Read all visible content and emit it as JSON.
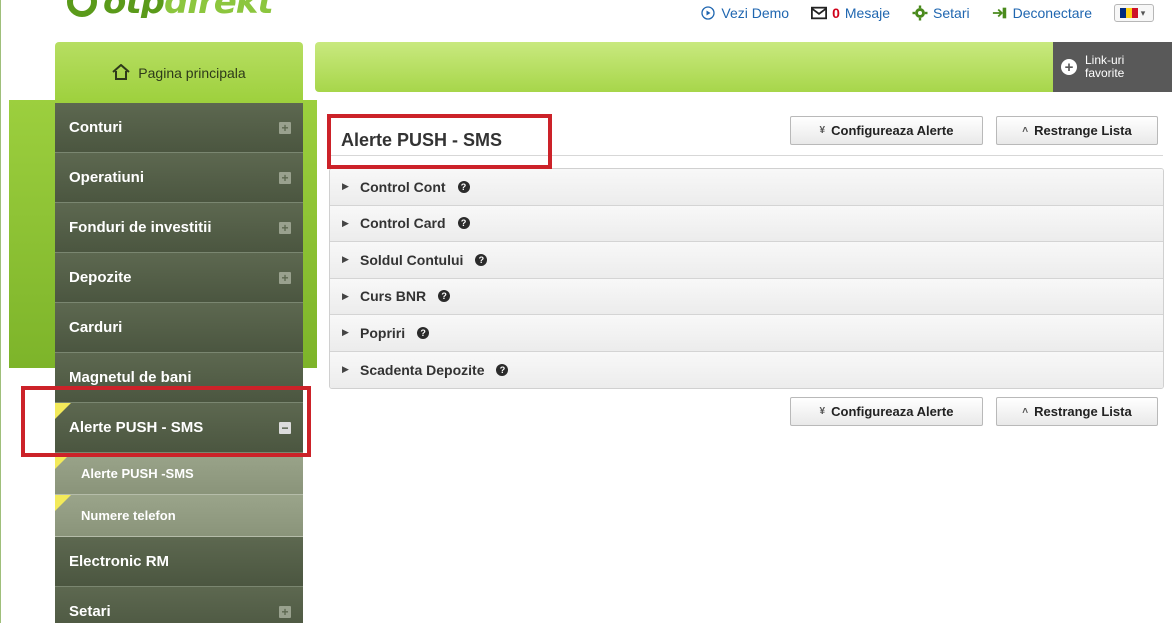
{
  "brand": {
    "logo_main": "otp",
    "logo_suffix": "direkt"
  },
  "topnav": {
    "demo": "Vezi Demo",
    "messages_count": "0",
    "messages": "Mesaje",
    "settings": "Setari",
    "logout": "Deconectare"
  },
  "home": {
    "label": "Pagina principala"
  },
  "favorites": {
    "line1": "Link-uri",
    "line2": "favorite"
  },
  "sidebar": {
    "items": [
      {
        "label": "Conturi",
        "toggle": "+"
      },
      {
        "label": "Operatiuni",
        "toggle": "+"
      },
      {
        "label": "Fonduri de investitii",
        "toggle": "+"
      },
      {
        "label": "Depozite",
        "toggle": "+"
      },
      {
        "label": "Carduri"
      },
      {
        "label": "Magnetul de bani"
      },
      {
        "label": "Alerte PUSH - SMS",
        "toggle": "−"
      },
      {
        "label": "Electronic RM"
      },
      {
        "label": "Setari",
        "toggle": "+"
      }
    ],
    "subitems": [
      {
        "label": "Alerte PUSH -SMS"
      },
      {
        "label": "Numere telefon"
      }
    ]
  },
  "main": {
    "title": "Alerte PUSH - SMS",
    "configure_label": "Configureaza Alerte",
    "collapse_label": "Restrange Lista",
    "sections": [
      {
        "label": "Control Cont"
      },
      {
        "label": "Control Card"
      },
      {
        "label": "Soldul Contului"
      },
      {
        "label": "Curs BNR"
      },
      {
        "label": "Popriri"
      },
      {
        "label": "Scadenta Depozite"
      }
    ]
  },
  "colors": {
    "accent_green": "#9dd03c",
    "sidebar_dark": "#4b5640",
    "highlight_red": "#cc2229",
    "link_blue": "#1f66b0"
  }
}
